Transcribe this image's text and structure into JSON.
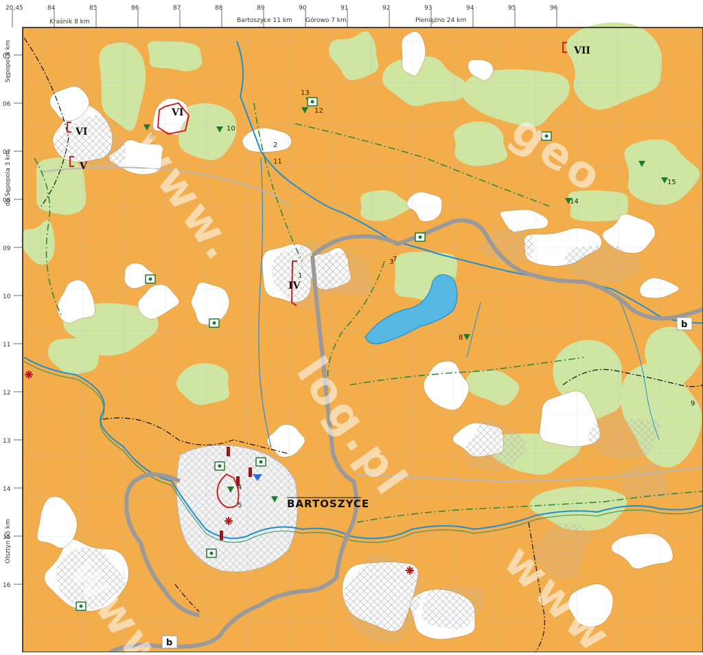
{
  "map": {
    "top_ticks": [
      "20,45",
      "84",
      "85",
      "86",
      "87",
      "88",
      "89",
      "90",
      "91",
      "92",
      "93",
      "94",
      "95",
      "96"
    ],
    "top_notes": [
      "Kraśnik 8 km",
      "Bartoszyce 11 km",
      "Górowo 7 km",
      "Pieniężno 24 km"
    ],
    "left_ticks": [
      "05",
      "06",
      "07",
      "08",
      "09",
      "10",
      "11",
      "12",
      "13",
      "14",
      "15",
      "16"
    ],
    "left_notes": [
      "Sępopol 8 km",
      "do Sępopola 3 km",
      "Olsztyn 65 km"
    ],
    "town_label": "BARTOSZYCE",
    "site_numbers": [
      "1",
      "2",
      "3",
      "4",
      "5",
      "6",
      "7",
      "8",
      "9",
      "10",
      "11",
      "12",
      "13",
      "14",
      "15"
    ],
    "roman_numerals": [
      "IV",
      "V",
      "VI",
      "VII",
      "VI"
    ],
    "road_badge_a": "b",
    "road_badge_b": "b",
    "watermarks": [
      "www.",
      "geo",
      "log.pl",
      "www",
      "www."
    ],
    "colors": {
      "orange_area": "#f3ad4a",
      "green_area": "#cfe6a3",
      "white_area": "#ffffff",
      "lake": "#55b7e3",
      "river": "#1e8fd0",
      "road_gray": "#9a9a9a",
      "boundary_green": "#2e8a3a",
      "boundary_black": "#111111",
      "symbol_red": "#cc2222"
    },
    "icons": [
      "triangle-site-icon",
      "square-site-icon",
      "red-bracket-icon",
      "asterisk-site-icon",
      "church-icon"
    ]
  }
}
